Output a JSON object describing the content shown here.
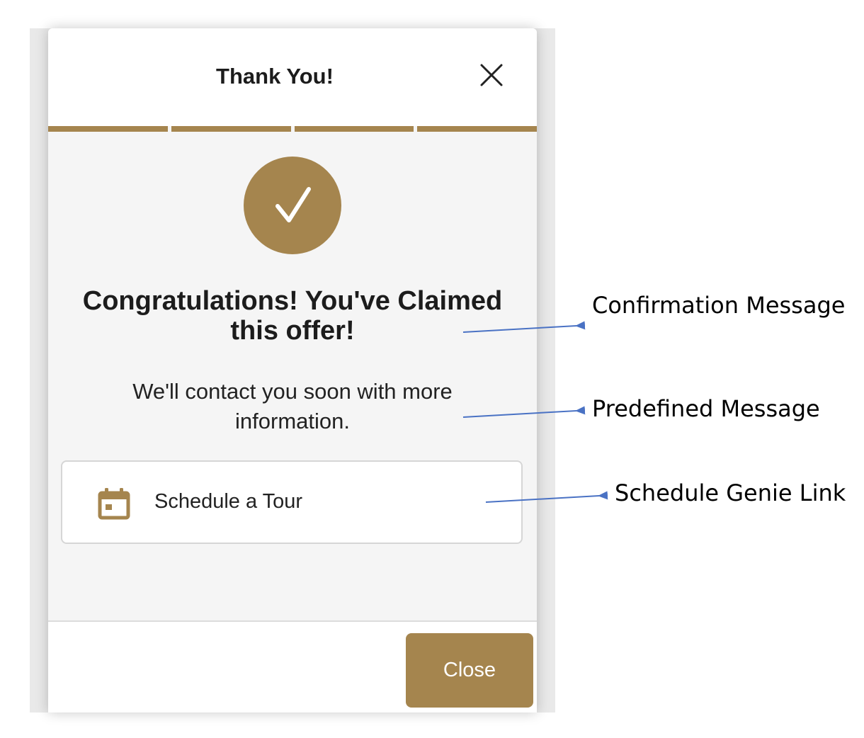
{
  "modal": {
    "title": "Thank You!",
    "close_icon": "close-icon",
    "progress_segments": 4,
    "headline": "Congratulations! You've Claimed this offer!",
    "message": "We'll contact you soon with more information.",
    "schedule_link": {
      "icon": "calendar-icon",
      "label": "Schedule a Tour"
    },
    "close_button_label": "Close"
  },
  "annotations": {
    "confirmation": "Confirmation Message",
    "predefined": "Predefined Message",
    "schedule_genie": "Schedule Genie Link"
  },
  "colors": {
    "accent": "#a5854e",
    "arrow": "#4a72c4",
    "body_bg": "#f5f5f5"
  }
}
